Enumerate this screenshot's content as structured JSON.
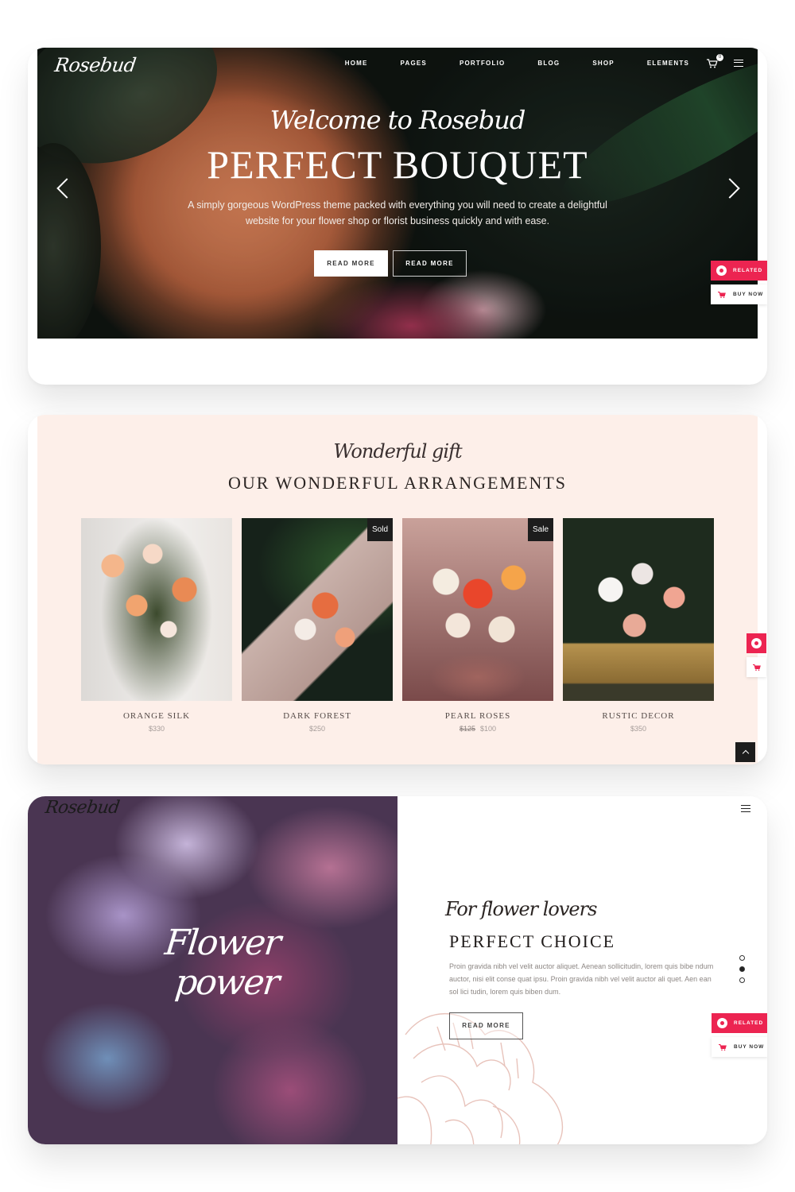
{
  "brand": {
    "logo": "Rosebud",
    "accent_color": "#ec2451"
  },
  "hero": {
    "nav": [
      "HOME",
      "PAGES",
      "PORTFOLIO",
      "BLOG",
      "SHOP",
      "ELEMENTS"
    ],
    "cart_count": "0",
    "welcome_script": "Welcome to Rosebud",
    "title": "PERFECT BOUQUET",
    "description": "A simply gorgeous WordPress theme packed with everything you will need to create a delightful website for your flower shop or florist business quickly and with ease.",
    "buttons": [
      "READ MORE",
      "READ MORE"
    ]
  },
  "side_widget": {
    "related": "RELATED",
    "buy_now": "BUY NOW"
  },
  "arrangements": {
    "script": "Wonderful gift",
    "title": "OUR WONDERFUL ARRANGEMENTS",
    "products": [
      {
        "name": "ORANGE SILK",
        "price": "$330",
        "old_price": "",
        "badge": ""
      },
      {
        "name": "DARK FOREST",
        "price": "$250",
        "old_price": "",
        "badge": "Sold"
      },
      {
        "name": "PEARL ROSES",
        "price": "$100",
        "old_price": "$125",
        "badge": "Sale"
      },
      {
        "name": "RUSTIC DECOR",
        "price": "$350",
        "old_price": "",
        "badge": ""
      }
    ]
  },
  "split": {
    "image_script": [
      "Flower",
      "power"
    ],
    "script": "For flower lovers",
    "title": "PERFECT CHOICE",
    "body": "Proin gravida nibh vel velit auctor aliquet. Aenean sollicitudin, lorem quis bibe ndum auctor, nisi elit conse quat ipsu. Proin gravida nibh vel velit auctor ali quet. Aen ean sol lici tudin, lorem quis biben dum.",
    "button": "READ MORE",
    "slides": 3,
    "active_slide": 2
  }
}
